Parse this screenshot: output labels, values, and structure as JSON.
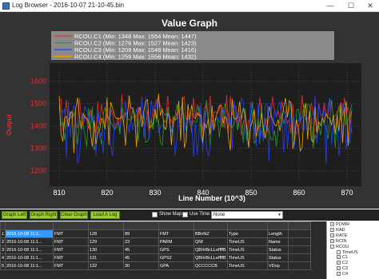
{
  "window": {
    "title": "Log Browser - 2016-10-07 21-10-45.bin",
    "min_glyph": "—",
    "max_glyph": "☐",
    "close_glyph": "✕"
  },
  "chart_data": {
    "type": "line",
    "title": "Value Graph",
    "xlabel": "Line Number (10^3)",
    "ylabel": "Output",
    "xlim": [
      808,
      873
    ],
    "ylim": [
      1130,
      1680
    ],
    "x_ticks": [
      810,
      820,
      830,
      840,
      850,
      860,
      870
    ],
    "y_ticks": [
      1200,
      1300,
      1400,
      1500,
      1600
    ],
    "legend": [
      "RCOU.C1 (Min: 1348 Max: 1554 Mean: 1447)",
      "RCOU.C2 (Min: 1276 Max: 1527 Mean: 1423)",
      "RCOU.C3 (Min: 1209 Max: 1548 Mean: 1416)",
      "RCOU.C4 (Min: 1259 Max: 1556 Mean: 1432)"
    ],
    "series": [
      {
        "name": "RCOU.C1",
        "color": "#e03030",
        "mean": 1447,
        "min": 1348,
        "max": 1554
      },
      {
        "name": "RCOU.C2",
        "color": "#22a022",
        "mean": 1423,
        "min": 1276,
        "max": 1527
      },
      {
        "name": "RCOU.C3",
        "color": "#2040ff",
        "mean": 1416,
        "min": 1209,
        "max": 1548
      },
      {
        "name": "RCOU.C4",
        "color": "#f0a000",
        "mean": 1432,
        "min": 1259,
        "max": 1556
      }
    ],
    "grid": true,
    "legend_position": "top"
  },
  "controls": {
    "graph_left": "Graph Left",
    "graph_right": "Graph Right",
    "clear_graph": "Clear Graph",
    "load_log": "Load A Log",
    "show_map": "Show Map",
    "use_time": "Use Time",
    "select_value": "None"
  },
  "table": {
    "rows": [
      [
        "",
        "",
        "",
        "",
        "",
        "",
        "",
        "",
        "",
        ""
      ],
      [
        "1",
        "2016-10-08 11:1...",
        "FMT",
        "128",
        "89",
        "FMT",
        "BBnNZ",
        "Type",
        "Length",
        ""
      ],
      [
        "2",
        "2016-10-08 11:1...",
        "FMT",
        "129",
        "23",
        "PARM",
        "QNf",
        "TimeUS",
        "Name",
        ""
      ],
      [
        "3",
        "2016-10-08 11:1...",
        "FMT",
        "130",
        "45",
        "GPS",
        "QBIHBcLLeffffB",
        "TimeUS",
        "Status",
        ""
      ],
      [
        "4",
        "2016-10-08 11:1...",
        "FMT",
        "131",
        "45",
        "GPS2",
        "QBIHBcLLeffffB",
        "TimeUS",
        "Status",
        ""
      ],
      [
        "5",
        "2016-10-08 11:1...",
        "FMT",
        "132",
        "30",
        "GPA",
        "QCCCCCB",
        "TimeUS",
        "VDop",
        ""
      ]
    ]
  },
  "tree": {
    "items": [
      "POWR",
      "RAD",
      "RATE",
      "RCIN",
      "RCOU",
      "TimeUS",
      "C1",
      "C2",
      "C3",
      "C4"
    ]
  }
}
